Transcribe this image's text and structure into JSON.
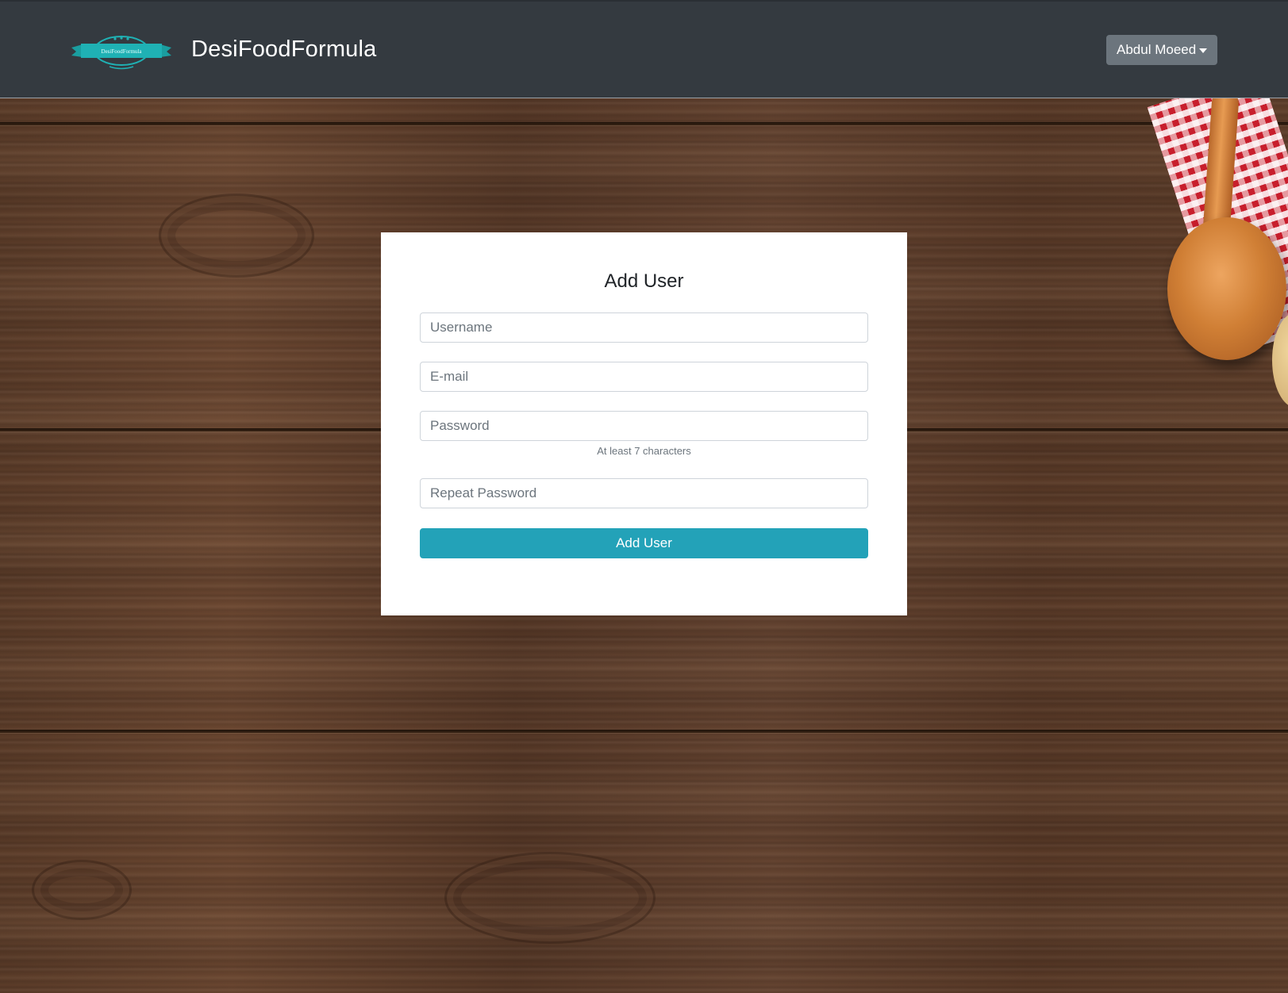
{
  "navbar": {
    "logo_text": "DesiFoodFormula",
    "brand": "DesiFoodFormula",
    "user_menu_label": "Abdul Moeed"
  },
  "form": {
    "title": "Add User",
    "username_placeholder": "Username",
    "email_placeholder": "E-mail",
    "password_placeholder": "Password",
    "password_help": "At least 7 characters",
    "repeat_password_placeholder": "Repeat Password",
    "submit_label": "Add User"
  },
  "colors": {
    "navbar_bg": "#343a40",
    "user_button_bg": "#6c757d",
    "submit_bg": "#23a2b8",
    "logo_teal": "#1fb1b4"
  },
  "icons": [
    "logo-banner-icon",
    "dropdown-caret-icon"
  ]
}
